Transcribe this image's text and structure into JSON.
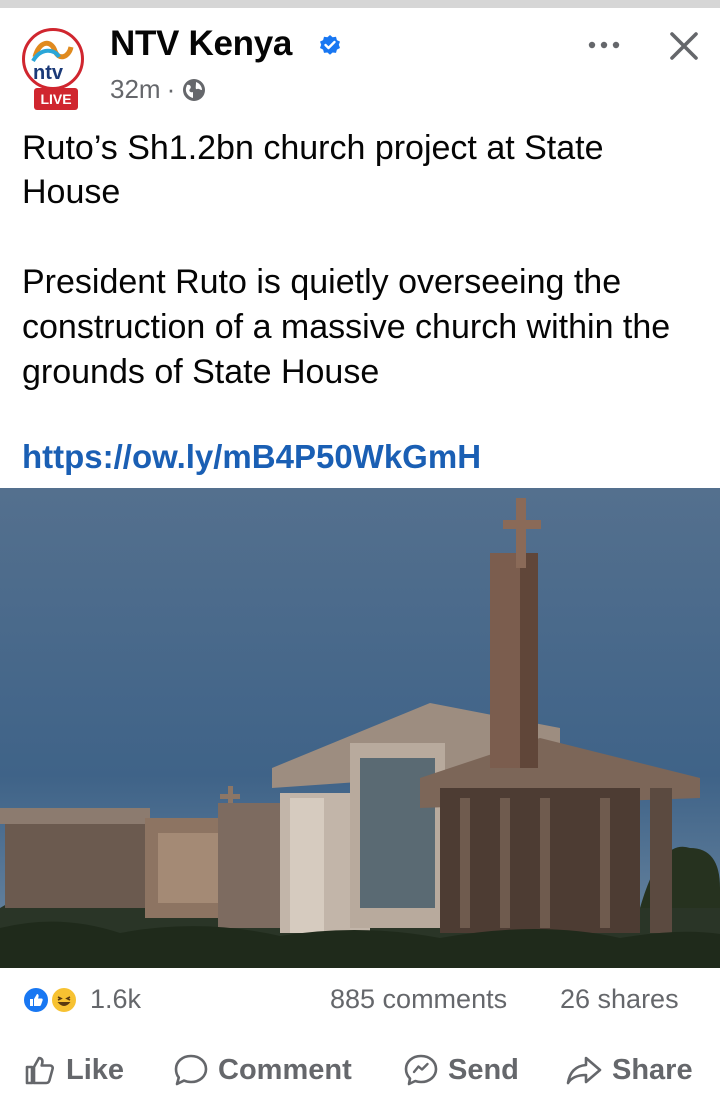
{
  "post": {
    "page_name": "NTV Kenya",
    "avatar_logo_text": "ntv",
    "live_badge": "LIVE",
    "time": "32m",
    "separator": "·",
    "headline": "Ruto’s Sh1.2bn church project at State House",
    "body": "President Ruto is quietly overseeing the construction of a massive church within the grounds of State House",
    "link": "https://ow.ly/mB4P50WkGmH"
  },
  "icons": {
    "verified": "verified-badge-icon",
    "audience": "globe-icon",
    "more": "more-options-icon",
    "close": "close-icon",
    "like": "thumbs-up-icon",
    "comment": "comment-bubble-icon",
    "send": "messenger-icon",
    "share": "share-arrow-icon"
  },
  "stats": {
    "reactions_count": "1.6k",
    "comments": "885 comments",
    "shares": "26 shares"
  },
  "actions": {
    "like": "Like",
    "comment": "Comment",
    "send": "Send",
    "share": "Share"
  },
  "colors": {
    "link": "#1a5fb4",
    "secondary_text": "#65676b",
    "brand_red": "#d0262f",
    "facebook_blue": "#1877f2"
  }
}
